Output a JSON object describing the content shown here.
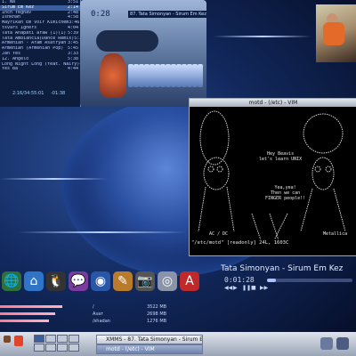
{
  "playlist": {
    "items": [
      {
        "title": "1. Na",
        "time": "3:51"
      },
      {
        "title": "Sirum Em Kez",
        "time": "2:14"
      },
      {
        "title": "Inch Yeghav",
        "time": "2:48"
      },
      {
        "title": "Ishkhan",
        "time": "4:58"
      },
      {
        "title": "Mayrikan Em Voir Kimichem",
        "time": "3:46"
      },
      {
        "title": "tsvars Ighers",
        "time": "4:04"
      },
      {
        "title": "Tata Anapati araw (1)(1)",
        "time": "5:39"
      },
      {
        "title": "Tata Ambiancia(Dance Remix)",
        "time": "5:29"
      },
      {
        "title": "Armenian - Aram Asatryan",
        "time": "3:45"
      },
      {
        "title": "Armenian (Armenian Pop)",
        "time": "5:45"
      },
      {
        "title": "Jan Yes",
        "time": "3:33"
      },
      {
        "title": "12. Angelo",
        "time": "5:38"
      },
      {
        "title": "Long Night Long (feat. Nairy)",
        "time": "4:55"
      },
      {
        "title": "Yes Ba",
        "time": "4:44"
      }
    ],
    "status_time": "2:16/34:55:01",
    "status_extra": "-01:38"
  },
  "player": {
    "time": "0:28",
    "title": "87. Tata Simonyan - Sirum Em Kez(2:14)",
    "vis_label": "kbps",
    "bars_count": 14
  },
  "vim": {
    "window_title": "motd - (/etc) - VIM",
    "text_hey": "Hey Beavis\nlet's learn UNIX",
    "text_yea": "Yea,yea!\nThen we can\nFINGER people!!",
    "text_acdc": "AC / DC",
    "text_metallica": "Metallica",
    "status_line": "\"/etc/motd\" [readonly] 24L, 1603C"
  },
  "now_playing": {
    "title": "Tata Simonyan - Sirum Em Kez",
    "time": "0:01:28",
    "progress_fraction": 0.1,
    "controls": [
      "◀◀",
      "▶",
      "❚❚",
      "■",
      "▶▶"
    ]
  },
  "memory": [
    {
      "label": "/",
      "value": "3522 MB",
      "fraction": 0.7
    },
    {
      "label": "Азат",
      "value": "2698 MB",
      "fraction": 0.62
    },
    {
      "label": "/shadan",
      "value": "1276 MB",
      "fraction": 0.55
    }
  ],
  "dock": {
    "icons": [
      "globe-icon",
      "house-icon",
      "penguin-icon",
      "chat-icon",
      "disc-icon",
      "paint-icon",
      "camera-icon",
      "disk-icon",
      "pdf-icon"
    ]
  },
  "taskbar": {
    "tasks": [
      {
        "label": "XMMS - 87. Tata Simonyan - Sirum Em Kez",
        "active": false
      },
      {
        "label": "motd - (/etc) - VIM",
        "active": true
      }
    ],
    "workspaces": 8,
    "current_workspace": 0
  },
  "colors": {
    "accent": "#3a5e9e",
    "mem_bar": "#ff7a8e"
  }
}
